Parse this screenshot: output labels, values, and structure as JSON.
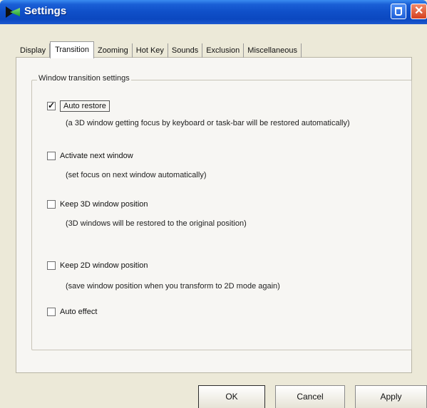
{
  "window": {
    "title": "Settings"
  },
  "tabs": [
    {
      "label": "Display",
      "active": false
    },
    {
      "label": "Transition",
      "active": true
    },
    {
      "label": "Zooming",
      "active": false
    },
    {
      "label": "Hot Key",
      "active": false
    },
    {
      "label": "Sounds",
      "active": false
    },
    {
      "label": "Exclusion",
      "active": false
    },
    {
      "label": "Miscellaneous",
      "active": false
    }
  ],
  "group": {
    "title": "Window transition settings"
  },
  "options": [
    {
      "label": "Auto restore",
      "checked": true,
      "description": "(a 3D window getting focus by keyboard or task-bar will be restored automatically)"
    },
    {
      "label": "Activate next window",
      "checked": false,
      "description": "(set focus on next window automatically)"
    },
    {
      "label": "Keep 3D window position",
      "checked": false,
      "description": "(3D windows will be restored to the original position)"
    },
    {
      "label": "Keep 2D window position",
      "checked": false,
      "description": "(save window position when you transform to 2D mode again)"
    },
    {
      "label": "Auto effect",
      "checked": false,
      "description": ""
    }
  ],
  "buttons": {
    "ok": "OK",
    "cancel": "Cancel",
    "apply": "Apply"
  },
  "colors": {
    "titlebar": "#0b48c0",
    "dialog_bg": "#ece9d8",
    "close_button": "#d5401f"
  }
}
